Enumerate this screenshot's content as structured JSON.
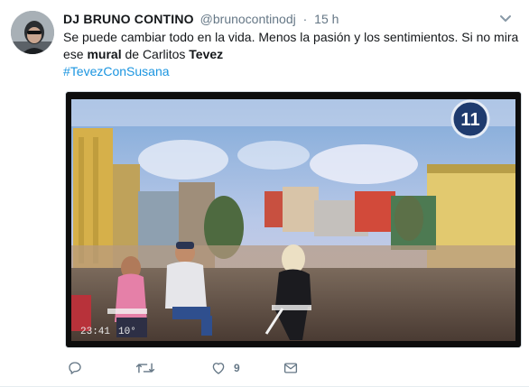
{
  "tweet": {
    "author_name": "DJ BRUNO CONTINO",
    "handle": "@brunocontinodj",
    "separator": "·",
    "timestamp": "15 h",
    "text_part1": "Se puede cambiar todo en la vida. Menos la pasión y los sentimientos. Si no mira ese ",
    "text_bold1": "mural",
    "text_part2": " de Carlitos ",
    "text_bold2": "Tevez",
    "hashtag": "#TevezConSusana"
  },
  "media": {
    "channel_logo_number": "11",
    "overlay_time": "23:41",
    "overlay_temp": "10°"
  },
  "actions": {
    "reply_icon": "reply-icon",
    "retweet_icon": "retweet-icon",
    "like_icon": "heart-icon",
    "like_count": "9",
    "message_icon": "envelope-icon"
  },
  "colors": {
    "link": "#1b95e0",
    "secondary_text": "#657786",
    "primary_text": "#14171a"
  }
}
